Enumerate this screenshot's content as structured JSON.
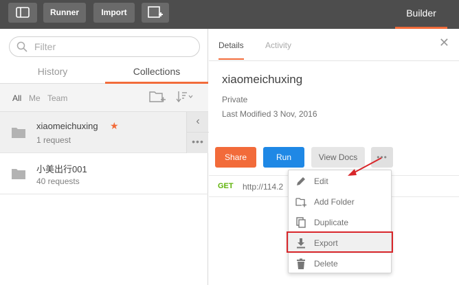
{
  "topbar": {
    "runner_label": "Runner",
    "import_label": "Import",
    "builder_label": "Builder",
    "sidebar_toggle_icon": "sidebar-toggle-icon",
    "new_window_icon": "new-window-icon"
  },
  "sidebar": {
    "search_placeholder": "Filter",
    "tabs": {
      "history": "History",
      "collections": "Collections"
    },
    "filters": {
      "all": "All",
      "me": "Me",
      "team": "Team"
    },
    "collections": [
      {
        "name": "xiaomeichuxing",
        "sub": "1 request",
        "starred": true
      },
      {
        "name": "小美出行001",
        "sub": "40 requests",
        "starred": false
      }
    ]
  },
  "detail": {
    "tabs": {
      "details": "Details",
      "activity": "Activity"
    },
    "title": "xiaomeichuxing",
    "privacy": "Private",
    "modified": "Last Modified 3 Nov, 2016",
    "buttons": {
      "share": "Share",
      "run": "Run",
      "docs": "View Docs"
    },
    "request": {
      "method": "GET",
      "url": "http://114.2"
    }
  },
  "menu": {
    "items": {
      "edit": "Edit",
      "add_folder": "Add Folder",
      "duplicate": "Duplicate",
      "export": "Export",
      "delete": "Delete"
    }
  },
  "colors": {
    "accent": "#f26b3a",
    "run": "#1f88e5",
    "highlight": "#d8262a",
    "get": "#5fb30a"
  }
}
